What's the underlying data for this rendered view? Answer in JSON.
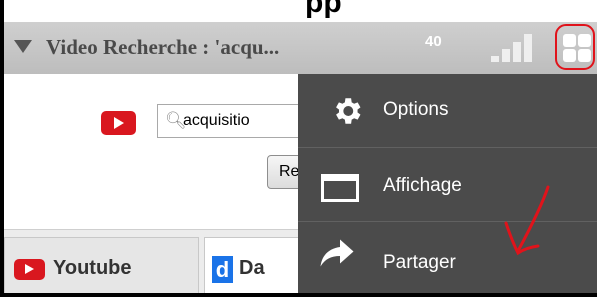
{
  "top_partial_text": "pp",
  "header": {
    "title": "Video Recherche : 'acqu...",
    "count": "40"
  },
  "search": {
    "value": "acquisitio",
    "submit_label": "Re"
  },
  "tabs": [
    {
      "label": "Youtube"
    },
    {
      "label": "Da",
      "icon_letter": "d"
    }
  ],
  "menu": {
    "items": [
      {
        "label": "Options",
        "icon": "gear-icon"
      },
      {
        "label": "Affichage",
        "icon": "window-icon"
      },
      {
        "label": "Partager",
        "icon": "share-arrow-icon"
      }
    ]
  },
  "colors": {
    "accent_red": "#e0131b",
    "menu_bg": "#4b4b4b",
    "header_bg": "#c6c6c6",
    "youtube_red": "#d9171f"
  }
}
